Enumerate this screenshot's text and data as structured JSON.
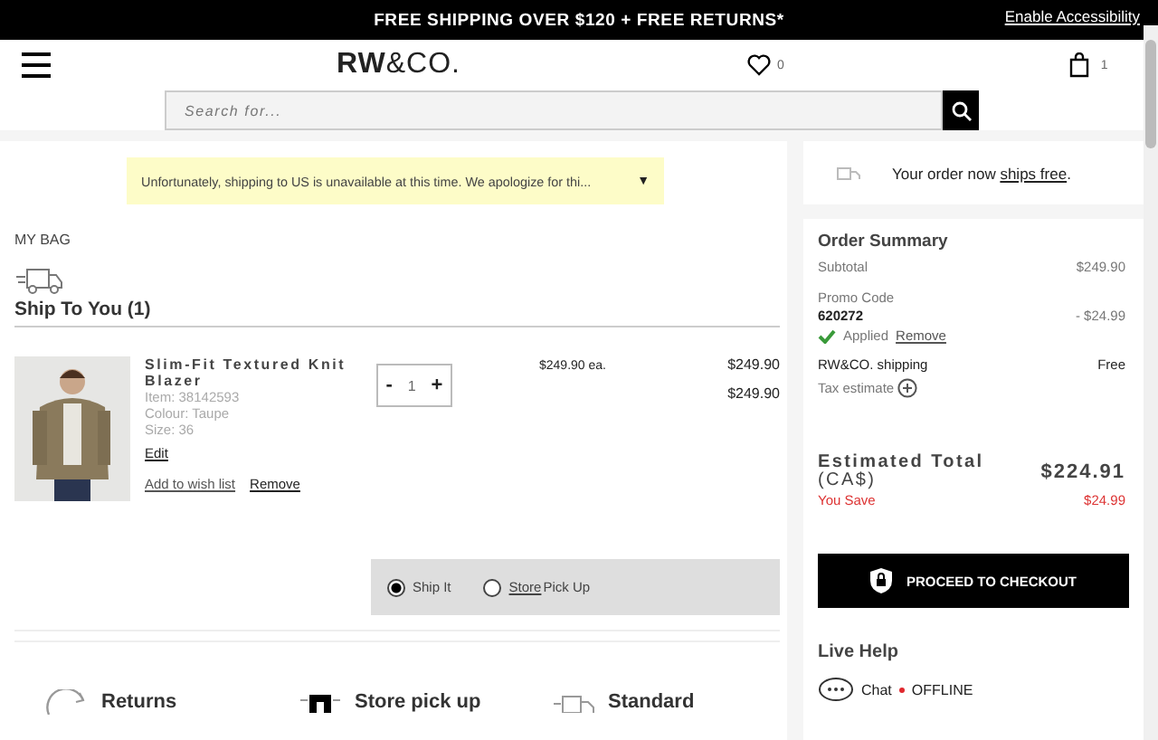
{
  "promo_bar": {
    "text": "FREE SHIPPING OVER $120 + FREE RETURNS*",
    "accessibility_link": "Enable Accessibility"
  },
  "header": {
    "logo_bold": "RW",
    "logo_rest": "&CO.",
    "wishlist_count": "0",
    "bag_count": "1"
  },
  "search": {
    "placeholder": "Search for..."
  },
  "notice": {
    "text": "Unfortunately, shipping to US is unavailable at this time. We apologize for thi...",
    "toggle": "▼"
  },
  "bag": {
    "title": "MY BAG",
    "section": "Ship To You (1)"
  },
  "item": {
    "kind": "picture",
    "name": "Slim-Fit Textured Knit Blazer",
    "details": [
      "Item: 38142593",
      "Colour: Taupe",
      "Size: 36"
    ],
    "edit": "Edit",
    "wishlist": "Add to wish list",
    "remove": "Remove",
    "minus": "-",
    "quantity": "1",
    "plus": "+",
    "unit_price": "$249.90 ea.",
    "price": "$249.90",
    "total": "$249.90"
  },
  "fulfillment": [
    {
      "label": "Ship It",
      "selected": true
    },
    {
      "link": "Store",
      "label": "Pick Up",
      "selected": false
    }
  ],
  "features": [
    {
      "kind": "returns",
      "label": "Returns"
    },
    {
      "kind": "store",
      "label": "Store pick up"
    },
    {
      "kind": "truck",
      "label": "Standard"
    }
  ],
  "free_shipping": {
    "text": "Your order now",
    "link": "ships free",
    "end": "."
  },
  "summary": {
    "title": "Order Summary",
    "subtotal_label": "Subtotal",
    "subtotal": "$249.90",
    "promo_label": "Promo Code",
    "promo_code": "620272",
    "promo_discount": "- $24.99",
    "applied": "Applied",
    "remove": "Remove",
    "shipping_label": "RW&CO. shipping",
    "shipping": "Free",
    "tax_label": "Tax estimate",
    "total_label": "Estimated Total",
    "currency": "(CA$)",
    "total": "$224.91",
    "save_label": "You Save",
    "save": "$24.99",
    "checkout": "PROCEED TO CHECKOUT"
  },
  "live_help": {
    "title": "Live Help",
    "chat": "Chat",
    "status": "OFFLINE",
    "online": false
  }
}
